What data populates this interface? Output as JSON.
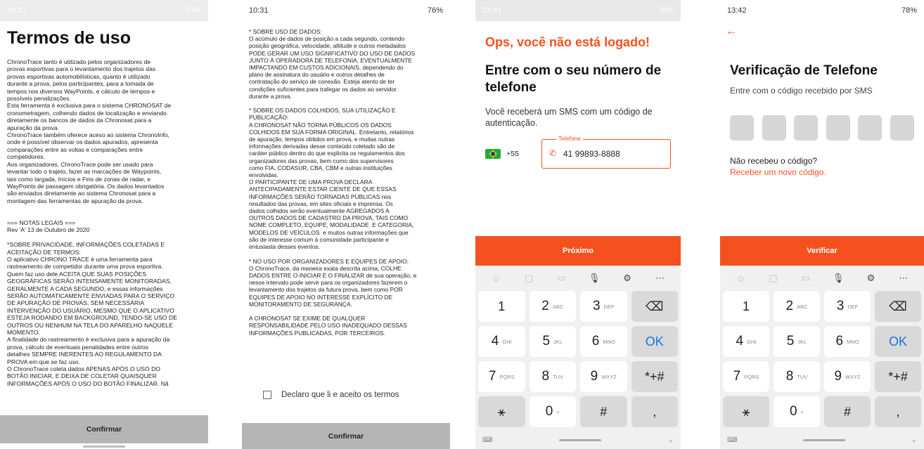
{
  "screens": {
    "terms1": {
      "status_time": "10:27",
      "status_battery": "77%",
      "title": "Termos de uso",
      "body": "ChronoTrace tanto é utilizado pelos organizadores de\nprovas esportivas para o levantamento dos trajetos das\nprovas esportivas automobilísticas, quanto é utilizado\ndurante a prova, pelos participantes, para a tomada de\ntempos nos diversos WayPoints, e cálculo de tempos e\npossíveis penalizações.\nEsta ferramenta é exclusiva para o sistema CHRONOSAT de\ncronometragem, colhendo dados de localização e enviando\ndiretamente os bancos de dados da Chronosat para a\napuração da prova.\nChronoTrace também oferece aceso ao sistema ChronoInfo,\nonde é possível observar os dados apurados, apresenta\ncomparações entre as voltas e comparações entre\ncompetidores.\nAos organizadores, ChronoTrace pode ser usado para\nlevantar todo o trajeto, fazer as marcações de Waypoints,\ntais como largada, Inícios e Fins de zonas de radar, e\nWayPoints de passagem obrigatória. Os dados levantados\nsão enviados diretamente ao sistema Chronosat para a\nmontagem das ferramentas de apuração da prova.\n\n\n=== NOTAS LEGAIS ===\nRev 'A' 13 de Outubro de 2020\n\n*SOBRE PRIVACIDADE, INFORMAÇÕES COLETADAS E\nACEITAÇÃO DE TERMOS:\nO aplicativo CHRONO TRACE é uma ferramenta para\nrastreamento de competidor durante uma prova esportiva.\nQuem faz uso dele ACEITA QUE SUAS POSIÇÕES\nGEOGRÁFICAS SERÃO INTENSAMENTE MONITORADAS,\nGERALMENTE A CADA SEGUNDO, e essas informações\nSERÃO AUTOMATICAMENTE ENVIADAS PARA O SERVIÇO\nDE APURAÇÃO DE PROVAS, SEM NECESSÁRIA\nINTERVENÇÃO DO USUÁRIO, MESMO QUE O APLICATIVO\nESTEJA RODANDO EM BACKGROUND, TENDO-SE USO DE\nOUTROS OU NENHUM NA TELA DO APARELHO NAQUELE\nMOMENTO.\nA finalidade do rastreamento é exclusiva para a apuração da\nprova, cálculo de eventuais penalidades entre outros\ndetalhes SEMPRE INERENTES AO REGULAMENTO DA\nPROVA em que se faz uso.\nO ChronoTrace coleta dados APENAS APÓS O USO DO\nBOTÃO INICIAR, E DEIXA DE COLETAR QUAISQUER\nINFORMAÇÕES APÓS O USO DO BOTÃO FINALIZAR. Nã",
      "confirm_label": "Confirmar"
    },
    "terms2": {
      "status_time": "10:31",
      "status_battery": "76%",
      "body": "* SOBRE USO DE DADOS:\nO acúmulo de dados de posição a cada segundo, contendo\nposição geográfica, velocidade, altitude e outros metadados\nPODE GERAR UM USO SIGNIFICATIVO DO USO DE DADOS\nJUNTO À OPERADORA DE TELEFONIA, EVENTUALMENTE\nIMPACTANDO EM CUSTOS ADICIONAIS, dependendo do\nplano de assinatura do usuário e outros detalhes de\ncontratação do serviço de conexão. Esteja atento de ter\ncondições suficientes para trafegar os dados ao servidor\ndurante a prova.\n\n* SOBRE OS DADOS COLHIDOS, SUA UTILIZAÇÃO E\nPUBLICAÇÃO:\nA CHRONOSAT NÃO TORNA PÚBLICOS OS DADOS\nCOLHIDOS EM SUA FORMA ORIGINAL. Entretanto, relatórios\nde apuração, tempos obtidos em prova, e muitas outras\ninformações derivadas desse conteúdo coletado são de\ncaráter público dentro do que explicita os regulamentos dos\norganizadores das provas, bem como dos supervisores\ncomo FIA, CODASUR, CBA, CBM e outras instituições\nenvolvidas.\nO PARTICIPANTE DE UMA PROVA DECLARA\nANTECIPADAMENTE ESTAR CIENTE DE QUE ESSAS\nINFORMAÇÕES SERÃO TORNADAS PÚBLICAS nos\nresultados das provas, em sites oficiais e imprensa. Os\ndados colhidos serão eventualmente AGREGADOS A\nOUTROS DADOS DE CADASTRO DA PROVA, TAIS COMO\nNOME COMPLETO, EQUIPE, MODALIDADE  E CATEGORIA,\nMODELOS DE VEÍCULOS  e muitos outras informações que\nsão de interesse comum à comunidade participante e\nentusiasta desses eventos.\n\n* NO USO POR ORGANIZADORES E EQUIPES DE APOIO:\nO ChronoTrace, da maneira exata descrita acima, COLHE\nDADOS ENTRE O INICIAR E O FINALIZAR de sua operação, e\nnesse intervalo pode servir para os organizadores fazerem o\nlevantamento dos trajetos da futura prova, bem como POR\nEQUIPES DE APOIO NO INTERESSE EXPLÍCITO DE\nMONITORAMENTO DE SEGURANÇA.\n\nA CHRONOSAT SE EXIME DE QUALQUER\nRESPONSABILIDADE PELO USO INADEQUADO DESSAS\nINFORMAÇÕES PUBLICADAS, POR TERCEIROS.",
      "accept_label": "Declaro que li e aceito os termos",
      "confirm_label": "Confirmar"
    },
    "login": {
      "status_time": "13:41",
      "status_battery": "78%",
      "oops": "Ops, você não está logado!",
      "heading": "Entre com o seu número de telefone",
      "subtitle": "Você receberá um SMS com um código de autenticação.",
      "dial_code": "+55",
      "field_label": "Telefone",
      "phone_value": "41 99893-8888",
      "next_label": "Próximo"
    },
    "verify": {
      "status_time": "13:42",
      "status_battery": "78%",
      "heading": "Verificação de Telefone",
      "subtitle": "Entre com o código recebido por SMS",
      "no_code": "Não recebeu o código?",
      "resend": "Receber um novo código.",
      "verify_label": "Verificar"
    }
  },
  "keyboard": {
    "keys": [
      {
        "n": "1",
        "l": ""
      },
      {
        "n": "2",
        "l": "ABC"
      },
      {
        "n": "3",
        "l": "DEF"
      },
      {
        "n": "⌫",
        "l": "",
        "func": true
      },
      {
        "n": "4",
        "l": "GHI"
      },
      {
        "n": "5",
        "l": "JKL"
      },
      {
        "n": "6",
        "l": "MNO"
      },
      {
        "n": "OK",
        "l": "",
        "func": true,
        "ok": true
      },
      {
        "n": "7",
        "l": "PQRS"
      },
      {
        "n": "8",
        "l": "TUV"
      },
      {
        "n": "9",
        "l": "WXYZ"
      },
      {
        "n": "*+#",
        "l": "",
        "func": true
      },
      {
        "n": "⚹",
        "l": "",
        "func": true
      },
      {
        "n": "0",
        "l": "+"
      },
      {
        "n": "#",
        "l": "",
        "func": true
      },
      {
        "n": ",",
        "l": "",
        "func": true
      }
    ]
  },
  "colors": {
    "accent": "#f4511e",
    "ok_blue": "#1a73e8"
  }
}
